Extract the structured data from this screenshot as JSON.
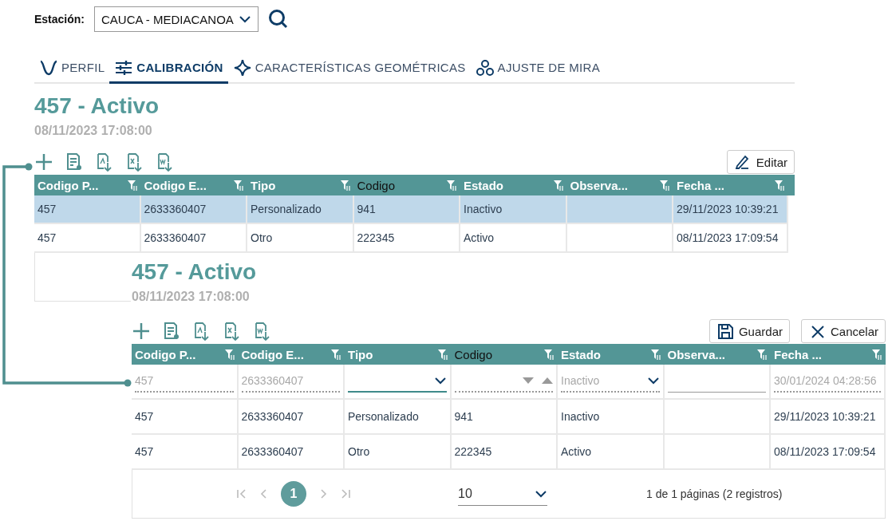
{
  "station": {
    "label": "Estación:",
    "value": "CAUCA - MEDIACANOA"
  },
  "tabs": [
    {
      "label": "PERFIL",
      "selected": false
    },
    {
      "label": "CALIBRACIÓN",
      "selected": true
    },
    {
      "label": "CARACTERÍSTICAS GEOMÉTRICAS",
      "selected": false
    },
    {
      "label": "AJUSTE DE MIRA",
      "selected": false
    }
  ],
  "panels": [
    {
      "title": "457 - Activo",
      "date": "08/11/2023 17:08:00",
      "buttons": [
        {
          "kind": "edit",
          "label": "Editar"
        }
      ],
      "columns": [
        {
          "label": "Codigo P...",
          "active": false
        },
        {
          "label": "Codigo E...",
          "active": false
        },
        {
          "label": "Tipo",
          "active": false
        },
        {
          "label": "Codigo",
          "active": true
        },
        {
          "label": "Estado",
          "active": false
        },
        {
          "label": "Observa...",
          "active": false
        },
        {
          "label": "Fecha ...",
          "active": false
        }
      ],
      "rows": [
        {
          "selected": true,
          "cells": [
            "457",
            "2633360407",
            "Personalizado",
            "941",
            "Inactivo",
            "",
            "29/11/2023 10:39:21"
          ]
        },
        {
          "selected": false,
          "cells": [
            "457",
            "2633360407",
            "Otro",
            "222345",
            "Activo",
            "",
            "08/11/2023 17:09:54"
          ]
        }
      ]
    },
    {
      "title": "457 - Activo",
      "date": "08/11/2023 17:08:00",
      "buttons": [
        {
          "kind": "save",
          "label": "Guardar"
        },
        {
          "kind": "cancel",
          "label": "Cancelar"
        }
      ],
      "columns": [
        {
          "label": "Codigo P...",
          "active": false
        },
        {
          "label": "Codigo E...",
          "active": false
        },
        {
          "label": "Tipo",
          "active": false
        },
        {
          "label": "Codigo",
          "active": true
        },
        {
          "label": "Estado",
          "active": false
        },
        {
          "label": "Observa...",
          "active": false
        },
        {
          "label": "Fecha ...",
          "active": false
        }
      ],
      "edit_row": [
        {
          "kind": "readonly",
          "value": "457"
        },
        {
          "kind": "readonly",
          "value": "2633360407"
        },
        {
          "kind": "select",
          "focused": true
        },
        {
          "kind": "number"
        },
        {
          "kind": "select",
          "value": "Inactivo",
          "focused": false
        },
        {
          "kind": "text"
        },
        {
          "kind": "readonly",
          "value": "30/01/2024 04:28:56"
        }
      ],
      "rows": [
        {
          "selected": false,
          "cells": [
            "457",
            "2633360407",
            "Personalizado",
            "941",
            "Inactivo",
            "",
            "29/11/2023 10:39:21"
          ]
        },
        {
          "selected": false,
          "cells": [
            "457",
            "2633360407",
            "Otro",
            "222345",
            "Activo",
            "",
            "08/11/2023 17:09:54"
          ]
        }
      ],
      "pager": {
        "pages": [
          {
            "label": "1",
            "selected": true
          }
        ],
        "page_size": "10",
        "summary": "1 de 1 páginas (2 registros)"
      }
    }
  ]
}
